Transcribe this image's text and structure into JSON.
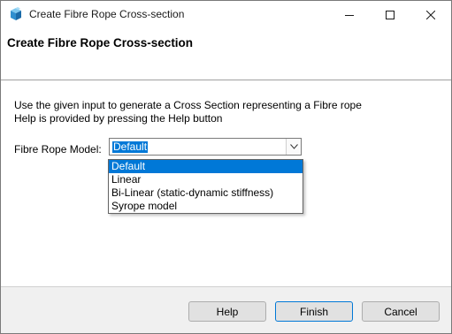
{
  "window": {
    "title": "Create Fibre Rope Cross-section",
    "icon": "app-cube-icon",
    "controls": [
      "minimize-icon",
      "maximize-icon",
      "close-icon"
    ]
  },
  "header": {
    "title": "Create Fibre Rope Cross-section"
  },
  "content": {
    "description_line1": "Use the given input to generate a Cross Section representing a Fibre rope",
    "description_line2": "Help is provided by pressing the Help button",
    "model_label": "Fibre Rope Model:",
    "model_selected": "Default",
    "model_options": [
      "Default",
      "Linear",
      "Bi-Linear (static-dynamic stiffness)",
      "Syrope model"
    ]
  },
  "footer": {
    "help_label": "Help",
    "finish_label": "Finish",
    "cancel_label": "Cancel"
  },
  "colors": {
    "accent": "#0078d7",
    "window_bg": "#f0f0f0",
    "panel_bg": "#ffffff"
  }
}
